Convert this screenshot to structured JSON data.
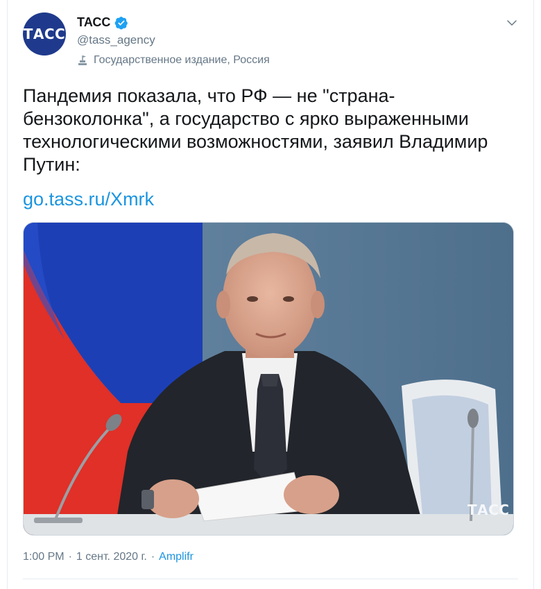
{
  "author": {
    "avatar_text": "ТАСС",
    "display_name": "ТАСС",
    "handle": "@tass_agency",
    "label": "Государственное издание, Россия"
  },
  "tweet": {
    "text": "Пандемия показала, что РФ — не \"страна-бензоколонка\", а государство с ярко выраженными технологическими возможностями, заявил Владимир Путин:",
    "link_text": "go.tass.ru/Xmrk"
  },
  "media": {
    "watermark": "ТАСС"
  },
  "meta": {
    "time": "1:00 PM",
    "date": "1 сент. 2020 г.",
    "separator": "·",
    "source": "Amplifr"
  },
  "colors": {
    "accent": "#1b95e0",
    "verified": "#1da1f2",
    "secondary_text": "#657786"
  }
}
